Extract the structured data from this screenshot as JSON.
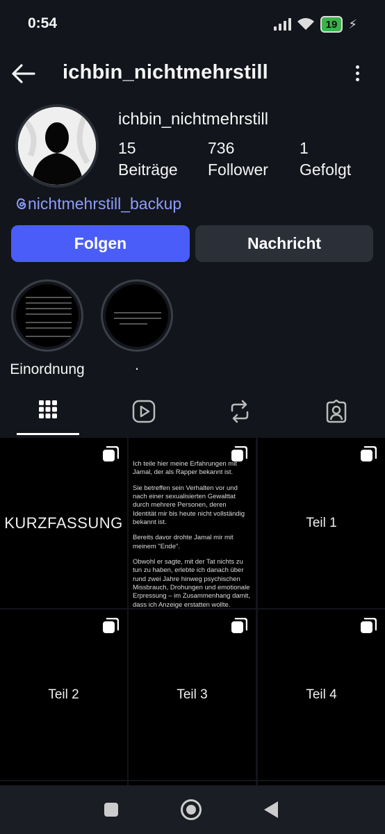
{
  "status_bar": {
    "time": "0:54",
    "battery": "19"
  },
  "header": {
    "title": "ichbin_nichtmehrstill"
  },
  "profile": {
    "name": "ichbin_nichtmehrstill",
    "stats": [
      {
        "value": "15",
        "label": "Beiträge"
      },
      {
        "value": "736",
        "label": "Follower"
      },
      {
        "value": "1",
        "label": "Gefolgt"
      }
    ],
    "threads_handle": "nichtmehrstill_backup"
  },
  "buttons": {
    "follow": "Folgen",
    "message": "Nachricht"
  },
  "highlights": [
    {
      "label": "Einordnung"
    },
    {
      "label": "."
    }
  ],
  "tabs": [
    "grid-icon",
    "reels-icon",
    "reposts-icon",
    "tagged-icon"
  ],
  "posts": [
    {
      "label": "KURZFASSUNG"
    },
    {
      "paragraphs": [
        "Ich teile hier meine Erfahrungen mit Jamal, der als Rapper bekannt ist.",
        "Sie betreffen sein Verhalten vor und nach einer sexualisierten Gewalttat durch mehrere Personen, deren Identität mir bis heute nicht vollständig bekannt ist.",
        "Bereits davor drohte Jamal mir mit meinem \"Ende\".",
        "Obwohl er sagte, mit der Tat nichts zu tun zu haben, erlebte ich danach über rund zwei Jahre hinweg psychischen Missbrauch, Drohungen und emotionale Erpressung – im Zusammenhang damit, dass ich Anzeige erstatten wollte."
      ]
    },
    {
      "label": "Teil 1"
    },
    {
      "label": "Teil 2"
    },
    {
      "label": "Teil 3"
    },
    {
      "label": "Teil 4"
    }
  ],
  "colors": {
    "accent": "#4a5df9",
    "link": "#8e9cff",
    "background": "#12151b"
  }
}
